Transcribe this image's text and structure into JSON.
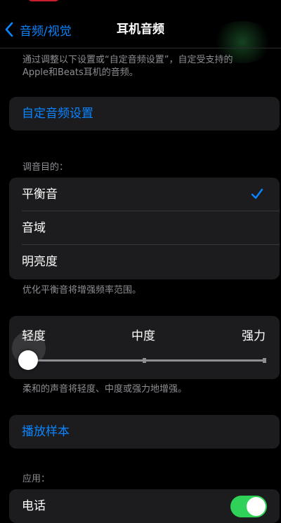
{
  "nav": {
    "back_label": "音频/视觉",
    "title": "耳机音频"
  },
  "intro_note": {
    "line1": "通过调整以下设置或“自定音频设置”，自定受支持的",
    "line2": "Apple和Beats耳机的音频。"
  },
  "custom_audio_setup_label": "自定音频设置",
  "tuning": {
    "header": "调音目的：",
    "options": [
      "平衡音",
      "音域",
      "明亮度"
    ],
    "selected_index": 0,
    "footer": "优化平衡音将增强频率范围。"
  },
  "strength": {
    "labels": [
      "轻度",
      "中度",
      "强力"
    ],
    "value": "轻度",
    "footer": "柔和的声音将轻度、中度或强力地增强。"
  },
  "play_sample_label": "播放样本",
  "apply": {
    "header": "应用：",
    "phone_label": "电话",
    "phone_enabled": true
  },
  "colors": {
    "accent": "#0a84ff",
    "toggle_on": "#30d158",
    "card": "#1c1c1e",
    "status_pill": "#c81e2d"
  }
}
